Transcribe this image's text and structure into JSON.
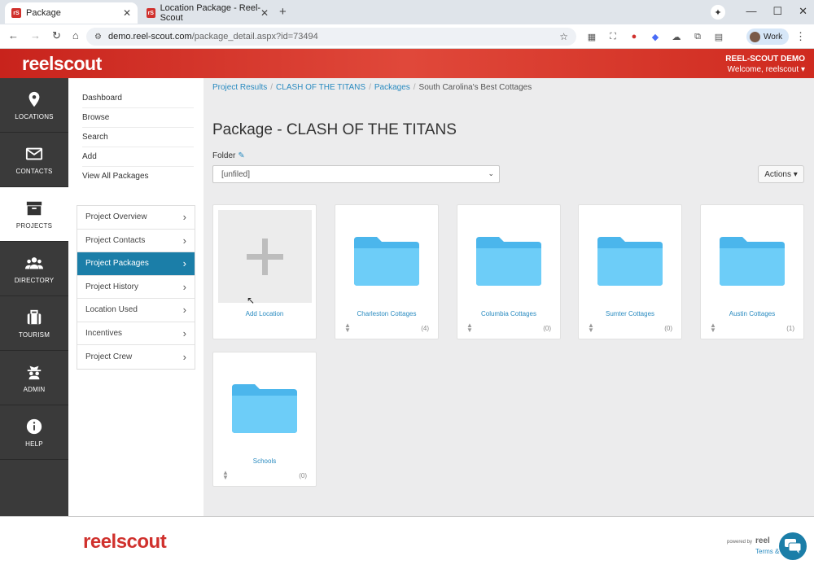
{
  "browser": {
    "tabs": [
      {
        "label": "Package",
        "favicon": "rS"
      },
      {
        "label": "Location Package - Reel-Scout",
        "favicon": "rS"
      }
    ],
    "url_domain": "demo.reel-scout.com",
    "url_path": "/package_detail.aspx?id=73494",
    "profile": "Work"
  },
  "header": {
    "brand": "reelscout",
    "org": "REEL-SCOUT DEMO",
    "welcome": "Welcome, reelscout ▾"
  },
  "rail": [
    {
      "label": "LOCATIONS",
      "icon": "map-pin-icon"
    },
    {
      "label": "CONTACTS",
      "icon": "envelope-icon"
    },
    {
      "label": "PROJECTS",
      "icon": "archive-box-icon",
      "active": true
    },
    {
      "label": "DIRECTORY",
      "icon": "people-icon"
    },
    {
      "label": "TOURISM",
      "icon": "suitcase-icon"
    },
    {
      "label": "ADMIN",
      "icon": "spy-icon"
    },
    {
      "label": "HELP",
      "icon": "info-icon"
    }
  ],
  "sublinks": [
    "Dashboard",
    "Browse",
    "Search",
    "Add",
    "View All Packages"
  ],
  "projmenu": [
    {
      "label": "Project Overview"
    },
    {
      "label": "Project Contacts"
    },
    {
      "label": "Project Packages",
      "active": true
    },
    {
      "label": "Project History"
    },
    {
      "label": "Location Used"
    },
    {
      "label": "Incentives"
    },
    {
      "label": "Project Crew"
    }
  ],
  "breadcrumbs": [
    "Project Results",
    "CLASH OF THE TITANS",
    "Packages",
    "South Carolina's Best Cottages"
  ],
  "page_title": "Package - CLASH OF THE TITANS",
  "folder": {
    "label": "Folder",
    "selected": "[unfiled]"
  },
  "actions_label": "Actions ▾",
  "add_location_label": "Add Location",
  "packages": [
    {
      "name": "Charleston Cottages",
      "count": "(4)"
    },
    {
      "name": "Columbia Cottages",
      "count": "(0)"
    },
    {
      "name": "Sumter Cottages",
      "count": "(0)"
    },
    {
      "name": "Austin Cottages",
      "count": "(1)"
    },
    {
      "name": "Schools",
      "count": "(0)"
    }
  ],
  "footer": {
    "brand": "reelscout",
    "powered_by": "powered by",
    "powered_brand": "reel",
    "terms": "Terms &"
  },
  "colors": {
    "brand_red": "#d0312d",
    "accent_blue": "#1b7ea8",
    "link_blue": "#2a8bc0",
    "folder_blue": "#5cc4f5"
  }
}
